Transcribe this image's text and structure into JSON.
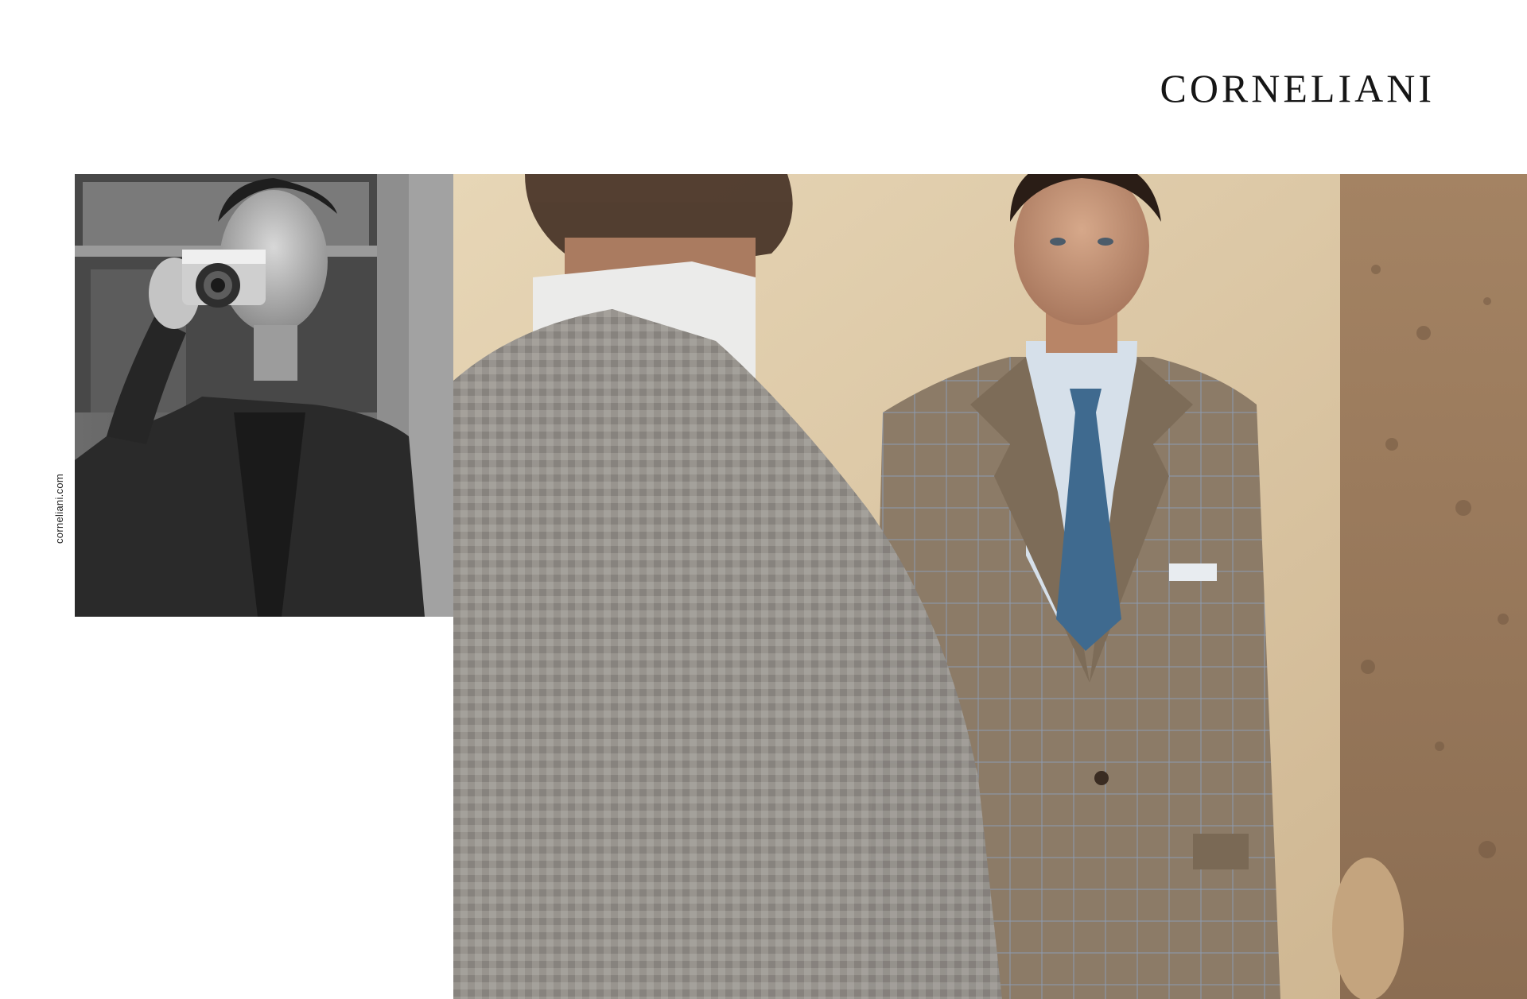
{
  "brand": {
    "logo_text": "CORNELIANI",
    "website": "corneliani.com"
  },
  "photos": {
    "small_photo": {
      "style": "black-and-white",
      "subject": "man-holding-camera"
    },
    "large_photo": {
      "style": "color",
      "subject": "man-in-suit-facing-mirror-reflection"
    }
  },
  "colors": {
    "background": "#ffffff",
    "logo": "#161616",
    "suit": "#8a7a66",
    "tie": "#3f6a8f",
    "shirt": "#d6e0ea",
    "wall": "#dfcda9",
    "stone": "#9c7f62",
    "jacket_back": "#8f8b86"
  }
}
